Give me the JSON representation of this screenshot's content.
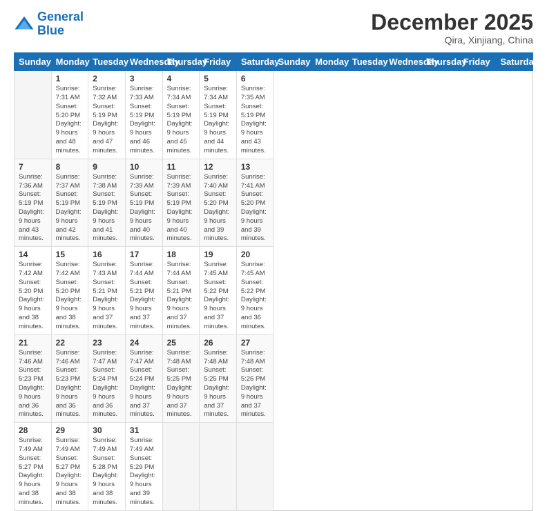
{
  "logo": {
    "line1": "General",
    "line2": "Blue"
  },
  "title": "December 2025",
  "subtitle": "Qira, Xinjiang, China",
  "days_header": [
    "Sunday",
    "Monday",
    "Tuesday",
    "Wednesday",
    "Thursday",
    "Friday",
    "Saturday"
  ],
  "weeks": [
    [
      {
        "num": "",
        "info": ""
      },
      {
        "num": "1",
        "info": "Sunrise: 7:31 AM\nSunset: 5:20 PM\nDaylight: 9 hours\nand 48 minutes."
      },
      {
        "num": "2",
        "info": "Sunrise: 7:32 AM\nSunset: 5:19 PM\nDaylight: 9 hours\nand 47 minutes."
      },
      {
        "num": "3",
        "info": "Sunrise: 7:33 AM\nSunset: 5:19 PM\nDaylight: 9 hours\nand 46 minutes."
      },
      {
        "num": "4",
        "info": "Sunrise: 7:34 AM\nSunset: 5:19 PM\nDaylight: 9 hours\nand 45 minutes."
      },
      {
        "num": "5",
        "info": "Sunrise: 7:34 AM\nSunset: 5:19 PM\nDaylight: 9 hours\nand 44 minutes."
      },
      {
        "num": "6",
        "info": "Sunrise: 7:35 AM\nSunset: 5:19 PM\nDaylight: 9 hours\nand 43 minutes."
      }
    ],
    [
      {
        "num": "7",
        "info": "Sunrise: 7:36 AM\nSunset: 5:19 PM\nDaylight: 9 hours\nand 43 minutes."
      },
      {
        "num": "8",
        "info": "Sunrise: 7:37 AM\nSunset: 5:19 PM\nDaylight: 9 hours\nand 42 minutes."
      },
      {
        "num": "9",
        "info": "Sunrise: 7:38 AM\nSunset: 5:19 PM\nDaylight: 9 hours\nand 41 minutes."
      },
      {
        "num": "10",
        "info": "Sunrise: 7:39 AM\nSunset: 5:19 PM\nDaylight: 9 hours\nand 40 minutes."
      },
      {
        "num": "11",
        "info": "Sunrise: 7:39 AM\nSunset: 5:19 PM\nDaylight: 9 hours\nand 40 minutes."
      },
      {
        "num": "12",
        "info": "Sunrise: 7:40 AM\nSunset: 5:20 PM\nDaylight: 9 hours\nand 39 minutes."
      },
      {
        "num": "13",
        "info": "Sunrise: 7:41 AM\nSunset: 5:20 PM\nDaylight: 9 hours\nand 39 minutes."
      }
    ],
    [
      {
        "num": "14",
        "info": "Sunrise: 7:42 AM\nSunset: 5:20 PM\nDaylight: 9 hours\nand 38 minutes."
      },
      {
        "num": "15",
        "info": "Sunrise: 7:42 AM\nSunset: 5:20 PM\nDaylight: 9 hours\nand 38 minutes."
      },
      {
        "num": "16",
        "info": "Sunrise: 7:43 AM\nSunset: 5:21 PM\nDaylight: 9 hours\nand 37 minutes."
      },
      {
        "num": "17",
        "info": "Sunrise: 7:44 AM\nSunset: 5:21 PM\nDaylight: 9 hours\nand 37 minutes."
      },
      {
        "num": "18",
        "info": "Sunrise: 7:44 AM\nSunset: 5:21 PM\nDaylight: 9 hours\nand 37 minutes."
      },
      {
        "num": "19",
        "info": "Sunrise: 7:45 AM\nSunset: 5:22 PM\nDaylight: 9 hours\nand 37 minutes."
      },
      {
        "num": "20",
        "info": "Sunrise: 7:45 AM\nSunset: 5:22 PM\nDaylight: 9 hours\nand 36 minutes."
      }
    ],
    [
      {
        "num": "21",
        "info": "Sunrise: 7:46 AM\nSunset: 5:23 PM\nDaylight: 9 hours\nand 36 minutes."
      },
      {
        "num": "22",
        "info": "Sunrise: 7:46 AM\nSunset: 5:23 PM\nDaylight: 9 hours\nand 36 minutes."
      },
      {
        "num": "23",
        "info": "Sunrise: 7:47 AM\nSunset: 5:24 PM\nDaylight: 9 hours\nand 36 minutes."
      },
      {
        "num": "24",
        "info": "Sunrise: 7:47 AM\nSunset: 5:24 PM\nDaylight: 9 hours\nand 37 minutes."
      },
      {
        "num": "25",
        "info": "Sunrise: 7:48 AM\nSunset: 5:25 PM\nDaylight: 9 hours\nand 37 minutes."
      },
      {
        "num": "26",
        "info": "Sunrise: 7:48 AM\nSunset: 5:25 PM\nDaylight: 9 hours\nand 37 minutes."
      },
      {
        "num": "27",
        "info": "Sunrise: 7:48 AM\nSunset: 5:26 PM\nDaylight: 9 hours\nand 37 minutes."
      }
    ],
    [
      {
        "num": "28",
        "info": "Sunrise: 7:49 AM\nSunset: 5:27 PM\nDaylight: 9 hours\nand 38 minutes."
      },
      {
        "num": "29",
        "info": "Sunrise: 7:49 AM\nSunset: 5:27 PM\nDaylight: 9 hours\nand 38 minutes."
      },
      {
        "num": "30",
        "info": "Sunrise: 7:49 AM\nSunset: 5:28 PM\nDaylight: 9 hours\nand 38 minutes."
      },
      {
        "num": "31",
        "info": "Sunrise: 7:49 AM\nSunset: 5:29 PM\nDaylight: 9 hours\nand 39 minutes."
      },
      {
        "num": "",
        "info": ""
      },
      {
        "num": "",
        "info": ""
      },
      {
        "num": "",
        "info": ""
      }
    ]
  ]
}
